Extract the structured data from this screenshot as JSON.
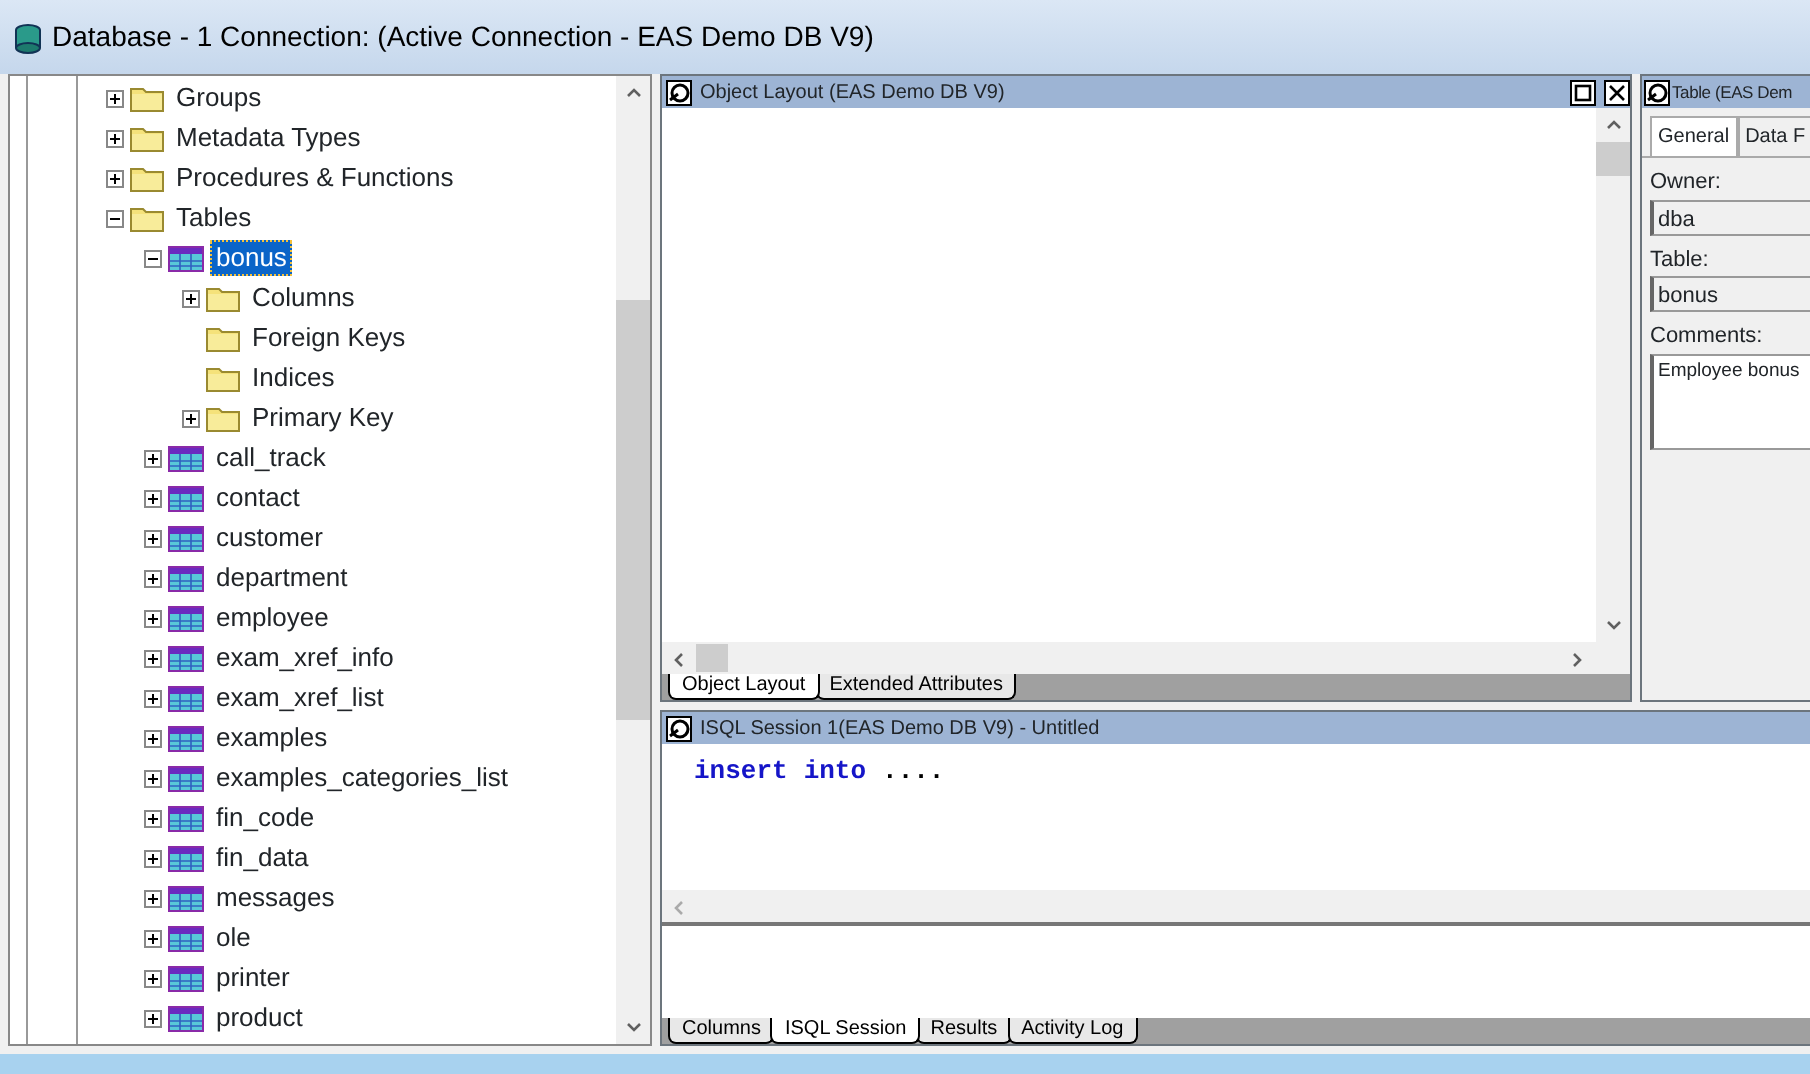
{
  "window": {
    "title": "Database - 1 Connection: (Active Connection - EAS Demo DB V9)"
  },
  "tree": [
    {
      "label": "Groups",
      "kind": "folder",
      "expanded": false,
      "selected": false
    },
    {
      "label": "Metadata Types",
      "kind": "folder",
      "expanded": false,
      "selected": false
    },
    {
      "label": "Procedures & Functions",
      "kind": "folder",
      "expanded": false,
      "selected": false
    },
    {
      "label": "Tables",
      "kind": "folder",
      "expanded": true,
      "selected": false,
      "children": [
        {
          "label": "bonus",
          "kind": "table",
          "expanded": true,
          "selected": true,
          "children": [
            {
              "label": "Columns",
              "kind": "folder",
              "expanded": false,
              "selected": false
            },
            {
              "label": "Foreign Keys",
              "kind": "folder",
              "selected": false
            },
            {
              "label": "Indices",
              "kind": "folder",
              "selected": false
            },
            {
              "label": "Primary Key",
              "kind": "folder",
              "expanded": false,
              "selected": false
            }
          ]
        },
        {
          "label": "call_track",
          "kind": "table",
          "expanded": false,
          "selected": false
        },
        {
          "label": "contact",
          "kind": "table",
          "expanded": false,
          "selected": false
        },
        {
          "label": "customer",
          "kind": "table",
          "expanded": false,
          "selected": false
        },
        {
          "label": "department",
          "kind": "table",
          "expanded": false,
          "selected": false
        },
        {
          "label": "employee",
          "kind": "table",
          "expanded": false,
          "selected": false
        },
        {
          "label": "exam_xref_info",
          "kind": "table",
          "expanded": false,
          "selected": false
        },
        {
          "label": "exam_xref_list",
          "kind": "table",
          "expanded": false,
          "selected": false
        },
        {
          "label": "examples",
          "kind": "table",
          "expanded": false,
          "selected": false
        },
        {
          "label": "examples_categories_list",
          "kind": "table",
          "expanded": false,
          "selected": false
        },
        {
          "label": "fin_code",
          "kind": "table",
          "expanded": false,
          "selected": false
        },
        {
          "label": "fin_data",
          "kind": "table",
          "expanded": false,
          "selected": false
        },
        {
          "label": "messages",
          "kind": "table",
          "expanded": false,
          "selected": false
        },
        {
          "label": "ole",
          "kind": "table",
          "expanded": false,
          "selected": false
        },
        {
          "label": "printer",
          "kind": "table",
          "expanded": false,
          "selected": false
        },
        {
          "label": "product",
          "kind": "table",
          "expanded": false,
          "selected": false
        }
      ]
    }
  ],
  "object_layout": {
    "title": "Object Layout (EAS Demo DB V9)",
    "tabs": [
      {
        "label": "Object Layout",
        "selected": true
      },
      {
        "label": "Extended Attributes",
        "selected": false
      }
    ]
  },
  "table_panel": {
    "title": "Table (EAS Dem",
    "tabs": [
      {
        "label": "General",
        "selected": true
      },
      {
        "label": "Data F",
        "selected": false
      }
    ],
    "fields": [
      {
        "label": "Owner:",
        "value": "dba",
        "kind": "line"
      },
      {
        "label": "Table:",
        "value": "bonus",
        "kind": "line"
      },
      {
        "label": "Comments:",
        "value": "Employee bonus",
        "kind": "area"
      }
    ]
  },
  "isql": {
    "title": "ISQL Session 1(EAS Demo DB V9) - Untitled",
    "code": [
      {
        "text": "insert",
        "kind": "keyword"
      },
      {
        "text": "into",
        "kind": "keyword"
      },
      {
        "text": "....",
        "kind": "plain"
      }
    ],
    "tabs": [
      {
        "label": "Columns",
        "selected": false
      },
      {
        "label": "ISQL Session",
        "selected": true
      },
      {
        "label": "Results",
        "selected": false
      },
      {
        "label": "Activity Log",
        "selected": false
      }
    ]
  }
}
